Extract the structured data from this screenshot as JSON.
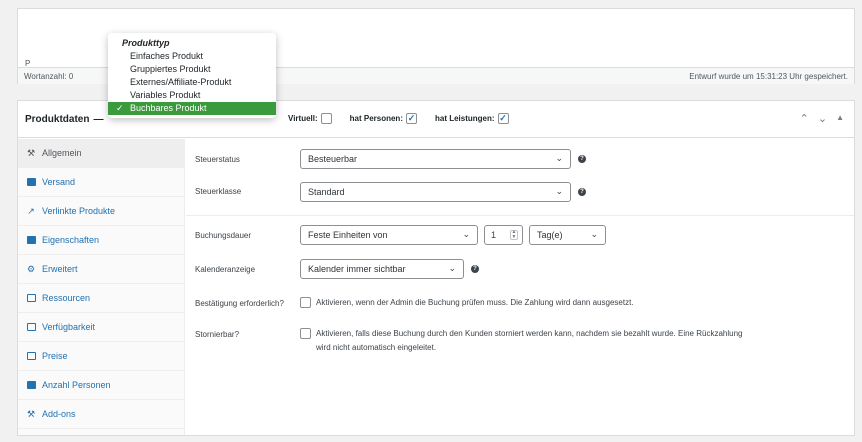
{
  "editor": {
    "paragraph_tag": "P",
    "word_count": "Wortanzahl: 0",
    "draft_status": "Entwurf wurde um 15:31:23 Uhr gespeichert."
  },
  "product_data": {
    "title": "Produktdaten",
    "dash": "—",
    "virtual_label": "Virtuell:",
    "virtual_checked": false,
    "persons_label": "hat Personen:",
    "persons_checked": true,
    "services_label": "hat Leistungen:",
    "services_checked": true,
    "check_mark": "✓"
  },
  "product_type_dropdown": {
    "group_label": "Produkttyp",
    "options": [
      "Einfaches Produkt",
      "Gruppiertes Produkt",
      "Externes/Affiliate-Produkt",
      "Variables Produkt",
      "Buchbares Produkt"
    ],
    "selected": "Buchbares Produkt",
    "selected_color": "#3b9a3b"
  },
  "tabs": [
    {
      "label": "Allgemein",
      "icon": "wrench-icon",
      "active": true
    },
    {
      "label": "Versand",
      "icon": "truck-icon",
      "active": false
    },
    {
      "label": "Verlinkte Produkte",
      "icon": "link-icon",
      "active": false
    },
    {
      "label": "Eigenschaften",
      "icon": "table-icon",
      "active": false
    },
    {
      "label": "Erweitert",
      "icon": "gear-icon",
      "active": false
    },
    {
      "label": "Ressourcen",
      "icon": "box-icon",
      "active": false
    },
    {
      "label": "Verfügbarkeit",
      "icon": "calendar-icon",
      "active": false
    },
    {
      "label": "Preise",
      "icon": "price-table-icon",
      "active": false
    },
    {
      "label": "Anzahl Personen",
      "icon": "people-icon",
      "active": false
    },
    {
      "label": "Add-ons",
      "icon": "plugin-icon",
      "active": false
    }
  ],
  "form": {
    "tax_status_label": "Steuerstatus",
    "tax_status_value": "Besteuerbar",
    "tax_class_label": "Steuerklasse",
    "tax_class_value": "Standard",
    "duration_label": "Buchungsdauer",
    "duration_type_value": "Feste Einheiten von",
    "duration_number": "1",
    "duration_unit_value": "Tag(e)",
    "calendar_label": "Kalenderanzeige",
    "calendar_value": "Kalender immer sichtbar",
    "confirm_label": "Bestätigung erforderlich?",
    "confirm_text": "Aktivieren, wenn der Admin die Buchung prüfen muss. Die Zahlung wird dann ausgesetzt.",
    "cancel_label": "Stornierbar?",
    "cancel_text_line1": "Aktivieren, falls diese Buchung durch den Kunden storniert werden kann, nachdem sie bezahlt wurde. Eine Rückzahlung",
    "cancel_text_line2": "wird nicht automatisch eingeleitet."
  },
  "colors": {
    "link_blue": "#2271b1",
    "border": "#dcdcde"
  }
}
